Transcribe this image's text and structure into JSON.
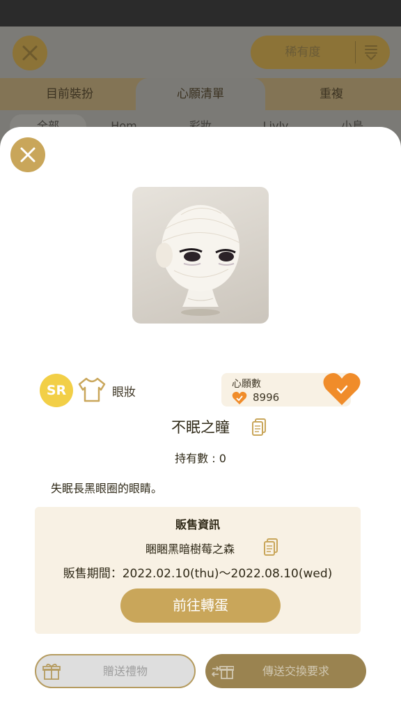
{
  "background": {
    "rarity_sort_label": "稀有度",
    "tabs": [
      "目前裝扮",
      "心願清單",
      "重複"
    ],
    "active_tab": "心願清單",
    "filters": [
      "全部",
      "Hom",
      "彩妝",
      "Livly",
      "小島"
    ]
  },
  "item": {
    "rarity": "SR",
    "category": "眼妝",
    "category_icon": "shirt-icon",
    "name": "不眠之瞳",
    "owned": "持有數 : 0",
    "description": "失眠長黑眼圈的眼睛。"
  },
  "wishlist": {
    "label": "心願數",
    "count": "8996",
    "accent_color": "#f08c2a"
  },
  "sales": {
    "title": "販售資訊",
    "gacha_name": "睏睏黑暗樹莓之森",
    "period": "販售期間：2022.02.10(thu)～2022.08.10(wed)",
    "go_button": "前往轉蛋"
  },
  "actions": {
    "gift": "贈送禮物",
    "trade": "傳送交換要求"
  },
  "colors": {
    "gold": "#c9a65a",
    "cream": "#f8f1e4",
    "rarity_yellow": "#f2cf47"
  }
}
